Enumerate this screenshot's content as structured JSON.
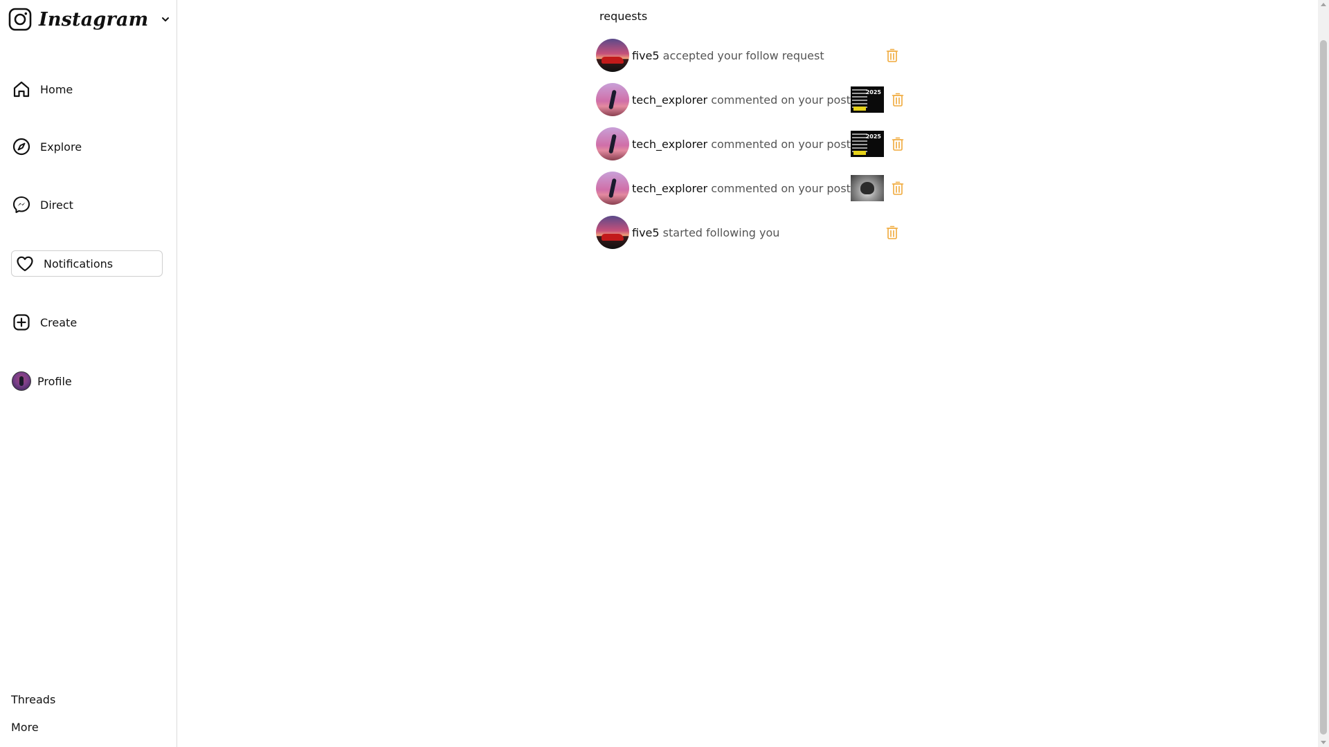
{
  "brand": {
    "wordmark": "Instagram",
    "logo_icon": "instagram-icon",
    "switch_icon": "chevron-down-icon"
  },
  "sidebar": {
    "items": [
      {
        "label": "Home",
        "icon": "home-icon"
      },
      {
        "label": "Explore",
        "icon": "compass-icon"
      },
      {
        "label": "Direct",
        "icon": "messenger-icon"
      },
      {
        "label": "Notifications",
        "icon": "heart-icon",
        "active": true
      },
      {
        "label": "Create",
        "icon": "plus-square-icon"
      },
      {
        "label": "Profile",
        "icon": "avatar"
      }
    ],
    "footer": {
      "threads": "Threads",
      "more": "More"
    }
  },
  "main": {
    "section_title": "requests",
    "notifications": [
      {
        "user": "five5",
        "action": "accepted your follow request",
        "avatar": "car",
        "thumbnail": null
      },
      {
        "user": "tech_explorer",
        "action": "commented on your post",
        "avatar": "dancer",
        "thumbnail": "dark",
        "thumb_text": "2025"
      },
      {
        "user": "tech_explorer",
        "action": "commented on your post",
        "avatar": "dancer",
        "thumbnail": "dark",
        "thumb_text": "2025"
      },
      {
        "user": "tech_explorer",
        "action": "commented on your post",
        "avatar": "dancer",
        "thumbnail": "light"
      },
      {
        "user": "five5",
        "action": "started following you",
        "avatar": "car",
        "thumbnail": null
      }
    ],
    "delete_icon": "trash-icon"
  },
  "colors": {
    "trash_accent": "#f0a93a",
    "muted_text": "#555555",
    "border": "#dbdbdb"
  }
}
